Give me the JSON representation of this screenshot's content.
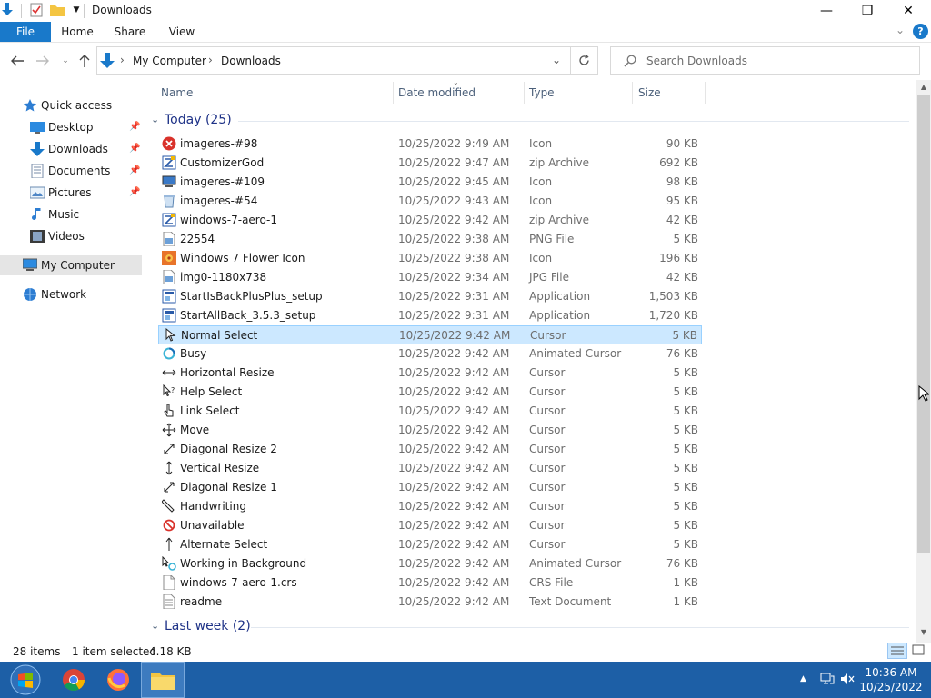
{
  "window": {
    "title": "Downloads",
    "minimize_glyph": "—",
    "maximize_glyph": "❐",
    "close_glyph": "✕",
    "collapse_glyph": "⌄",
    "help_glyph": "?"
  },
  "ribbon": {
    "tabs": [
      {
        "label": "File",
        "name": "tab-file"
      },
      {
        "label": "Home",
        "name": "tab-home"
      },
      {
        "label": "Share",
        "name": "tab-share"
      },
      {
        "label": "View",
        "name": "tab-view"
      }
    ]
  },
  "address": {
    "segments": [
      "My Computer",
      "Downloads"
    ],
    "separator": "›"
  },
  "search": {
    "placeholder": "Search Downloads"
  },
  "navpane": {
    "quick_access": "Quick access",
    "items": [
      {
        "label": "Desktop",
        "icon": "desktop-icon",
        "pinned": true
      },
      {
        "label": "Downloads",
        "icon": "downloads-icon",
        "pinned": true
      },
      {
        "label": "Documents",
        "icon": "documents-icon",
        "pinned": true
      },
      {
        "label": "Pictures",
        "icon": "pictures-icon",
        "pinned": true
      },
      {
        "label": "Music",
        "icon": "music-icon",
        "pinned": false
      },
      {
        "label": "Videos",
        "icon": "videos-icon",
        "pinned": false
      }
    ],
    "my_computer": "My Computer",
    "network": "Network"
  },
  "columns": {
    "name": "Name",
    "date": "Date modified",
    "type": "Type",
    "size": "Size"
  },
  "groups": {
    "today": "Today (25)",
    "last_week": "Last week (2)"
  },
  "files": [
    {
      "name": "imageres-#98",
      "date": "10/25/2022 9:49 AM",
      "type": "Icon",
      "size": "90 KB",
      "icon": "error-icon"
    },
    {
      "name": "CustomizerGod",
      "date": "10/25/2022 9:47 AM",
      "type": "zip Archive",
      "size": "692 KB",
      "icon": "zip-archive-icon"
    },
    {
      "name": "imageres-#109",
      "date": "10/25/2022 9:45 AM",
      "type": "Icon",
      "size": "98 KB",
      "icon": "computer-icon"
    },
    {
      "name": "imageres-#54",
      "date": "10/25/2022 9:43 AM",
      "type": "Icon",
      "size": "95 KB",
      "icon": "recycle-bin-icon"
    },
    {
      "name": "windows-7-aero-1",
      "date": "10/25/2022 9:42 AM",
      "type": "zip Archive",
      "size": "42 KB",
      "icon": "zip-archive-icon"
    },
    {
      "name": "22554",
      "date": "10/25/2022 9:38 AM",
      "type": "PNG File",
      "size": "5 KB",
      "icon": "image-file-icon"
    },
    {
      "name": "Windows 7 Flower Icon",
      "date": "10/25/2022 9:38 AM",
      "type": "Icon",
      "size": "196 KB",
      "icon": "flower-icon"
    },
    {
      "name": "img0-1180x738",
      "date": "10/25/2022 9:34 AM",
      "type": "JPG File",
      "size": "42 KB",
      "icon": "image-file-icon"
    },
    {
      "name": "StartIsBackPlusPlus_setup",
      "date": "10/25/2022 9:31 AM",
      "type": "Application",
      "size": "1,503 KB",
      "icon": "setup-icon"
    },
    {
      "name": "StartAllBack_3.5.3_setup",
      "date": "10/25/2022 9:31 AM",
      "type": "Application",
      "size": "1,720 KB",
      "icon": "setup-icon"
    },
    {
      "name": "Normal Select",
      "date": "10/25/2022 9:42 AM",
      "type": "Cursor",
      "size": "5 KB",
      "icon": "arrow-cursor-icon",
      "selected": true
    },
    {
      "name": "Busy",
      "date": "10/25/2022 9:42 AM",
      "type": "Animated Cursor",
      "size": "76 KB",
      "icon": "busy-cursor-icon"
    },
    {
      "name": "Horizontal Resize",
      "date": "10/25/2022 9:42 AM",
      "type": "Cursor",
      "size": "5 KB",
      "icon": "horizontal-resize-icon"
    },
    {
      "name": "Help Select",
      "date": "10/25/2022 9:42 AM",
      "type": "Cursor",
      "size": "5 KB",
      "icon": "help-cursor-icon"
    },
    {
      "name": "Link Select",
      "date": "10/25/2022 9:42 AM",
      "type": "Cursor",
      "size": "5 KB",
      "icon": "hand-cursor-icon"
    },
    {
      "name": "Move",
      "date": "10/25/2022 9:42 AM",
      "type": "Cursor",
      "size": "5 KB",
      "icon": "move-cursor-icon"
    },
    {
      "name": "Diagonal Resize 2",
      "date": "10/25/2022 9:42 AM",
      "type": "Cursor",
      "size": "5 KB",
      "icon": "diagonal-resize-icon"
    },
    {
      "name": "Vertical Resize",
      "date": "10/25/2022 9:42 AM",
      "type": "Cursor",
      "size": "5 KB",
      "icon": "vertical-resize-icon"
    },
    {
      "name": "Diagonal Resize 1",
      "date": "10/25/2022 9:42 AM",
      "type": "Cursor",
      "size": "5 KB",
      "icon": "diagonal-resize-icon"
    },
    {
      "name": "Handwriting",
      "date": "10/25/2022 9:42 AM",
      "type": "Cursor",
      "size": "5 KB",
      "icon": "pen-cursor-icon"
    },
    {
      "name": "Unavailable",
      "date": "10/25/2022 9:42 AM",
      "type": "Cursor",
      "size": "5 KB",
      "icon": "unavailable-cursor-icon"
    },
    {
      "name": "Alternate Select",
      "date": "10/25/2022 9:42 AM",
      "type": "Cursor",
      "size": "5 KB",
      "icon": "up-arrow-cursor-icon"
    },
    {
      "name": "Working in Background",
      "date": "10/25/2022 9:42 AM",
      "type": "Animated Cursor",
      "size": "76 KB",
      "icon": "working-cursor-icon"
    },
    {
      "name": "windows-7-aero-1.crs",
      "date": "10/25/2022 9:42 AM",
      "type": "CRS File",
      "size": "1 KB",
      "icon": "blank-file-icon"
    },
    {
      "name": "readme",
      "date": "10/25/2022 9:42 AM",
      "type": "Text Document",
      "size": "1 KB",
      "icon": "text-file-icon"
    }
  ],
  "status": {
    "items": "28 items",
    "selected": "1 item selected",
    "selected_size": "4.18 KB"
  },
  "taskbar": {
    "time": "10:36 AM",
    "date": "10/25/2022"
  },
  "colors": {
    "accent": "#1979ca",
    "selection": "#cce8ff",
    "taskbar": "#1d5fa6",
    "group_header": "#1e3287"
  }
}
